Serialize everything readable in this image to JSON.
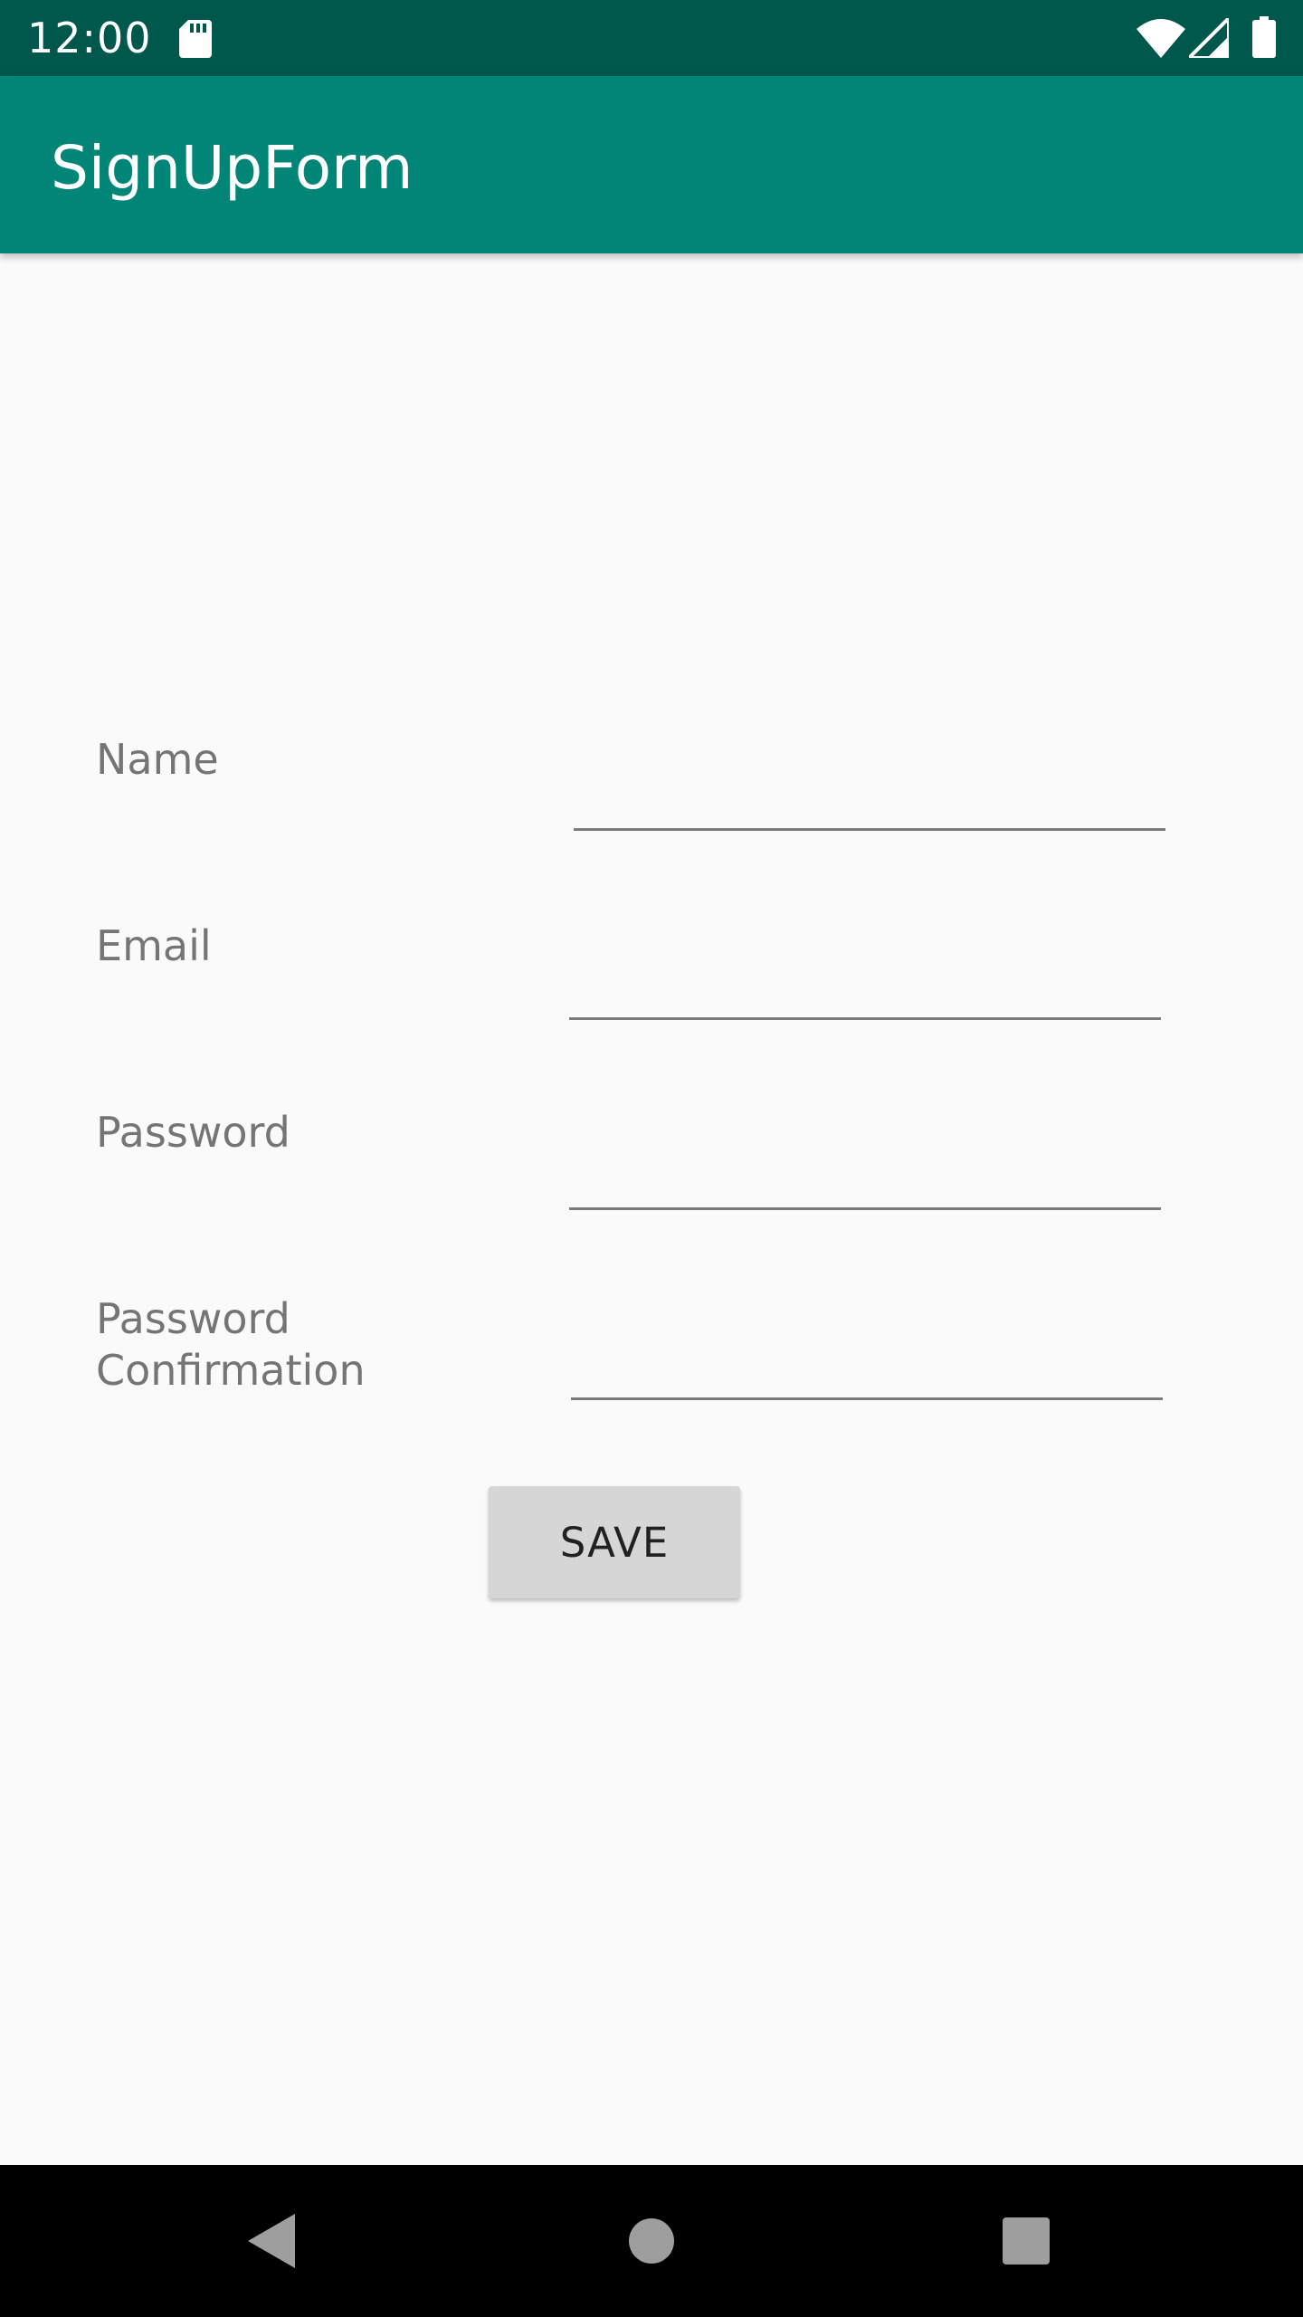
{
  "status_bar": {
    "time": "12:00",
    "icons": [
      "sd-card-icon",
      "wifi-icon",
      "cell-signal-icon",
      "battery-icon"
    ],
    "background_color": "#00574b"
  },
  "app_bar": {
    "title": "SignUpForm",
    "background_color": "#008577"
  },
  "form": {
    "fields": [
      {
        "label": "Name",
        "value": ""
      },
      {
        "label": "Email",
        "value": ""
      },
      {
        "label": "Password",
        "value": ""
      },
      {
        "label_line1": "Password",
        "label_line2": "Confirmation",
        "value": ""
      }
    ],
    "save_label": "SAVE"
  },
  "nav_bar": {
    "icons": [
      "back-icon",
      "home-icon",
      "recents-icon"
    ],
    "background_color": "#000000"
  }
}
